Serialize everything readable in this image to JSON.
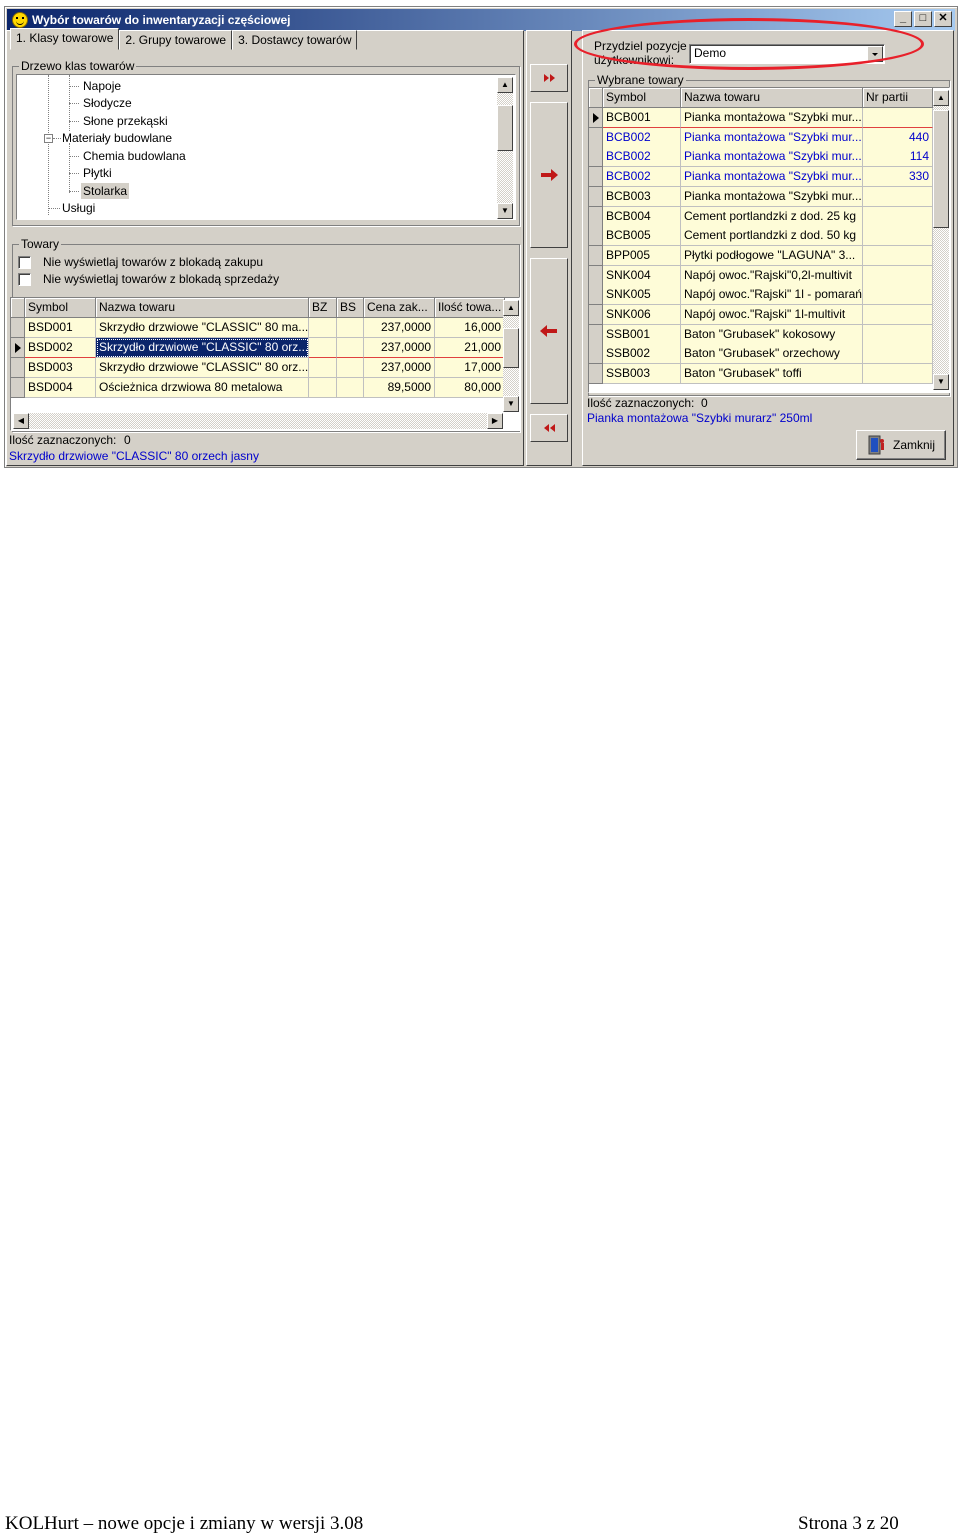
{
  "window": {
    "title": "Wybór towarów do inwentaryzacji częściowej",
    "min_glyph": "_",
    "max_glyph": "□",
    "close_glyph": "✕"
  },
  "tabs": [
    {
      "label": "1. Klasy towarowe"
    },
    {
      "label": "2. Grupy towarowe"
    },
    {
      "label": "3. Dostawcy towarów"
    }
  ],
  "tree": {
    "group_label": "Drzewo klas towarów",
    "items": [
      {
        "label": "Napoje"
      },
      {
        "label": "Słodycze"
      },
      {
        "label": "Słone przekąski"
      },
      {
        "label": "Materiały budowlane"
      },
      {
        "label": "Chemia budowlana"
      },
      {
        "label": "Płytki"
      },
      {
        "label": "Stolarka"
      },
      {
        "label": "Usługi"
      }
    ]
  },
  "goods_panel": {
    "group_label": "Towary",
    "checkbox_purchase_block": "Nie wyświetlaj towarów z blokadą zakupu",
    "checkbox_sale_block": "Nie wyświetlaj towarów z blokadą sprzedaży",
    "headers": [
      "Symbol",
      "Nazwa towaru",
      "BZ",
      "BS",
      "Cena zak...",
      "Ilość towa..."
    ],
    "rows": [
      {
        "symbol": "BSD001",
        "name": "Skrzydło drzwiowe \"CLASSIC\" 80 ma...",
        "bz": "",
        "bs": "",
        "price": "237,0000",
        "qty": "16,000"
      },
      {
        "symbol": "BSD002",
        "name": "Skrzydło drzwiowe \"CLASSIC\" 80 orz...",
        "bz": "",
        "bs": "",
        "price": "237,0000",
        "qty": "21,000"
      },
      {
        "symbol": "BSD003",
        "name": "Skrzydło drzwiowe \"CLASSIC\" 80 orz...",
        "bz": "",
        "bs": "",
        "price": "237,0000",
        "qty": "17,000"
      },
      {
        "symbol": "BSD004",
        "name": "Ościeżnica drzwiowa 80 metalowa",
        "bz": "",
        "bs": "",
        "price": "89,5000",
        "qty": "80,000"
      }
    ],
    "count_label": "Ilość zaznaczonych:",
    "count_value": "0",
    "current_item": "Skrzydło drzwiowe \"CLASSIC\" 80 orzech jasny"
  },
  "assign": {
    "label_line1": "Przydziel pozycje",
    "label_line2": "użytkownikowi:",
    "value": "Demo"
  },
  "selected_panel": {
    "group_label": "Wybrane towary",
    "headers": [
      "Symbol",
      "Nazwa towaru",
      "Nr partii"
    ],
    "rows": [
      {
        "symbol": "BCB001",
        "name": "Pianka montażowa \"Szybki mur...",
        "batch": ""
      },
      {
        "symbol": "BCB002",
        "name": "Pianka montażowa \"Szybki mur...",
        "batch": "440"
      },
      {
        "symbol": "BCB002",
        "name": "Pianka montażowa \"Szybki mur...",
        "batch": "114"
      },
      {
        "symbol": "BCB002",
        "name": "Pianka montażowa \"Szybki mur...",
        "batch": "330"
      },
      {
        "symbol": "BCB003",
        "name": "Pianka montażowa \"Szybki mur...",
        "batch": ""
      },
      {
        "symbol": "BCB004",
        "name": "Cement portlandzki z dod. 25 kg",
        "batch": ""
      },
      {
        "symbol": "BCB005",
        "name": "Cement portlandzki z dod. 50 kg",
        "batch": ""
      },
      {
        "symbol": "BPP005",
        "name": "Płytki podłogowe \"LAGUNA\" 3...",
        "batch": ""
      },
      {
        "symbol": "SNK004",
        "name": "Napój owoc.\"Rajski\"0,2l-multivit",
        "batch": ""
      },
      {
        "symbol": "SNK005",
        "name": "Napój owoc.\"Rajski\" 1l - pomarań",
        "batch": ""
      },
      {
        "symbol": "SNK006",
        "name": "Napój owoc.\"Rajski\" 1l-multivit",
        "batch": ""
      },
      {
        "symbol": "SSB001",
        "name": "Baton \"Grubasek\" kokosowy",
        "batch": ""
      },
      {
        "symbol": "SSB002",
        "name": "Baton \"Grubasek\" orzechowy",
        "batch": ""
      },
      {
        "symbol": "SSB003",
        "name": "Baton \"Grubasek\" toffi",
        "batch": ""
      }
    ],
    "count_label": "Ilość zaznaczonych:",
    "count_value": "0",
    "current_item": "Pianka montażowa \"Szybki murarz\" 250ml"
  },
  "close_button": {
    "label": "Zamknij"
  },
  "footer": {
    "left": "KOLHurt – nowe opcje i zmiany w wersji 3.08",
    "right": "Strona 3 z 20"
  },
  "colors": {
    "title_start": "#0a246a",
    "title_end": "#a6caf0",
    "row_yellow": "#fefcd8",
    "selection": "#0a246a",
    "highlight_red": "#e8202a",
    "link_blue": "#0000cc"
  }
}
